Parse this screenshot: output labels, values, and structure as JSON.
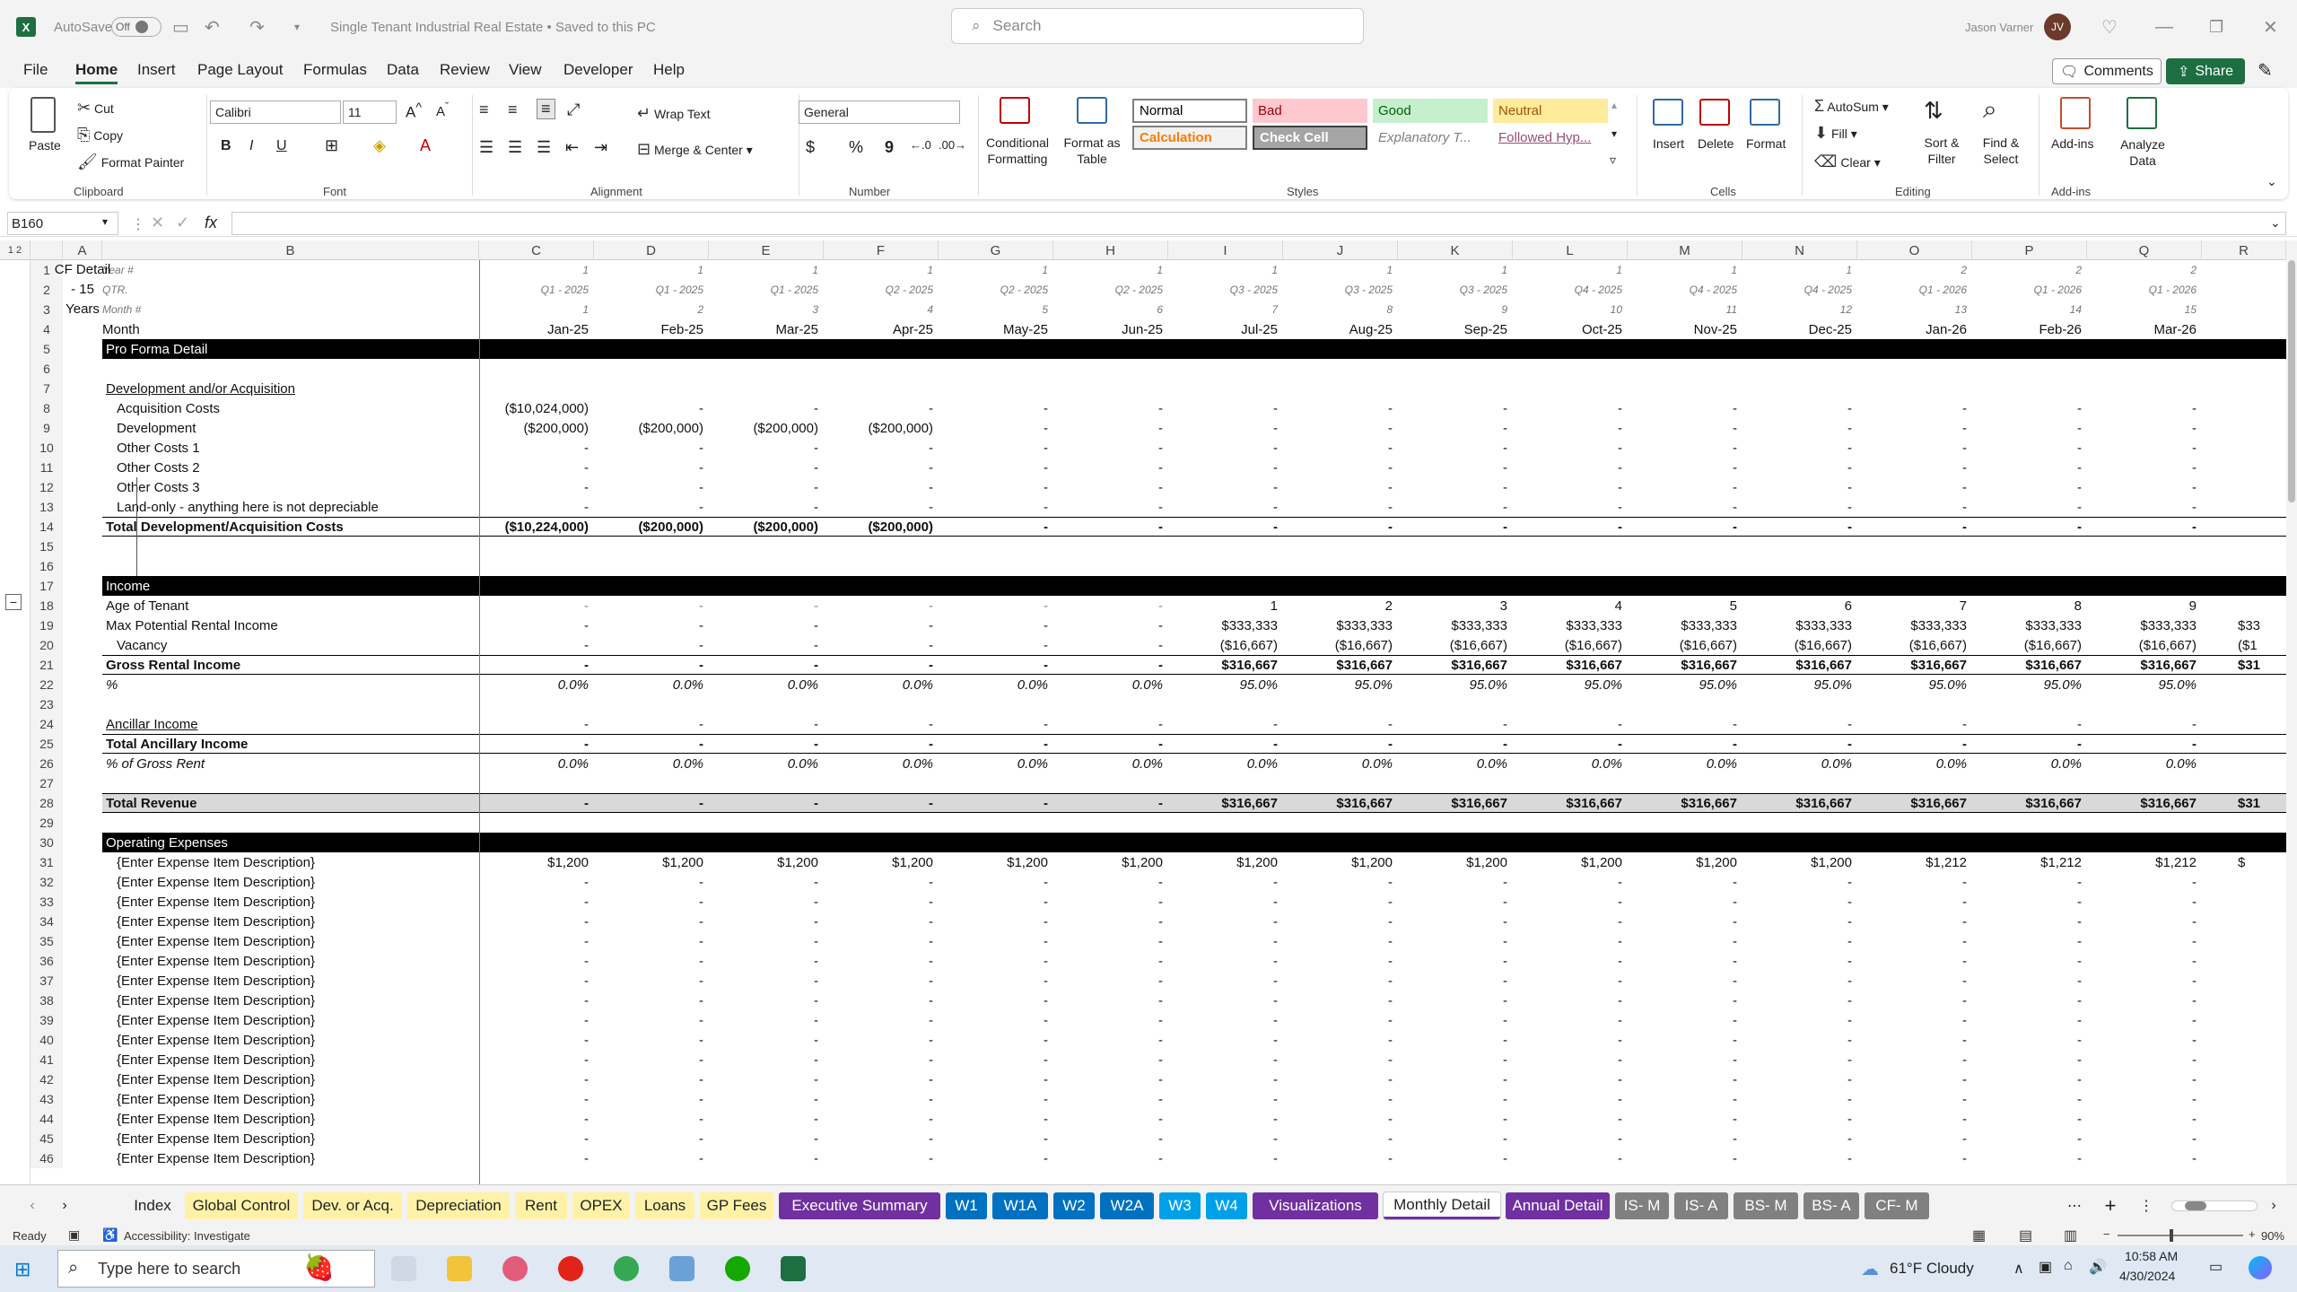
{
  "titlebar": {
    "autosave_label": "AutoSave",
    "autosave_state": "Off",
    "doc_title": "Single Tenant Industrial Real Estate • Saved to this PC",
    "search_placeholder": "Search",
    "user_name": "Jason Varner",
    "user_initials": "JV"
  },
  "menu": {
    "items": [
      "File",
      "Home",
      "Insert",
      "Page Layout",
      "Formulas",
      "Data",
      "Review",
      "View",
      "Developer",
      "Help"
    ],
    "active": "Home",
    "comments_label": "Comments",
    "share_label": "Share"
  },
  "ribbon": {
    "clipboard": {
      "paste": "Paste",
      "cut": "Cut",
      "copy": "Copy",
      "format_painter": "Format Painter",
      "label": "Clipboard"
    },
    "font": {
      "name": "Calibri",
      "size": "11",
      "label": "Font",
      "bold": "B",
      "italic": "I",
      "underline": "U"
    },
    "alignment": {
      "wrap": "Wrap Text",
      "merge": "Merge & Center",
      "label": "Alignment"
    },
    "number": {
      "format": "General",
      "currency": "$",
      "percent": "%",
      "comma": "9",
      "label": "Number"
    },
    "styles": {
      "conditional": "Conditional Formatting",
      "format_table": "Format as Table",
      "label": "Styles",
      "cells": [
        {
          "name": "Normal",
          "bg": "#ffffff",
          "fg": "#000000",
          "border": "#808080"
        },
        {
          "name": "Bad",
          "bg": "#ffc7ce",
          "fg": "#9c0006",
          "border": ""
        },
        {
          "name": "Good",
          "bg": "#c6efce",
          "fg": "#006100",
          "border": ""
        },
        {
          "name": "Neutral",
          "bg": "#ffeb9c",
          "fg": "#9c5700",
          "border": ""
        },
        {
          "name": "Calculation",
          "bg": "#f2f2f2",
          "fg": "#fa7d00",
          "border": "#7f7f7f"
        },
        {
          "name": "Check Cell",
          "bg": "#a5a5a5",
          "fg": "#ffffff",
          "border": "#3f3f3f"
        },
        {
          "name": "Explanatory T...",
          "bg": "#ffffff",
          "fg": "#7f7f7f",
          "border": ""
        },
        {
          "name": "Followed Hyp...",
          "bg": "#ffffff",
          "fg": "#954f72",
          "border": ""
        }
      ]
    },
    "cells_grp": {
      "insert": "Insert",
      "delete": "Delete",
      "format": "Format",
      "label": "Cells"
    },
    "editing": {
      "autosum": "AutoSum",
      "fill": "Fill",
      "clear": "Clear",
      "sort": "Sort & Filter",
      "find": "Find & Select",
      "label": "Editing"
    },
    "addins": {
      "addins": "Add-ins",
      "analyze": "Analyze Data",
      "label": "Add-ins"
    }
  },
  "formula_bar": {
    "name_box": "B160",
    "fx": "fx",
    "content": ""
  },
  "columns": [
    "A",
    "B",
    "C",
    "D",
    "E",
    "F",
    "G",
    "H",
    "I",
    "J",
    "K",
    "L",
    "M",
    "N",
    "O",
    "P",
    "Q",
    "R"
  ],
  "sheet": {
    "a_label": [
      "CF Detail",
      "- 15",
      "Years"
    ],
    "header_rows": {
      "year_label": "Year #",
      "qtr_label": "QTR.",
      "month_num_label": "Month #",
      "month_label": "Month",
      "years": [
        "1",
        "1",
        "1",
        "1",
        "1",
        "1",
        "1",
        "1",
        "1",
        "1",
        "1",
        "1",
        "2",
        "2",
        "2"
      ],
      "qtrs": [
        "Q1 - 2025",
        "Q1 - 2025",
        "Q1 - 2025",
        "Q2 - 2025",
        "Q2 - 2025",
        "Q2 - 2025",
        "Q3 - 2025",
        "Q3 - 2025",
        "Q3 - 2025",
        "Q4 - 2025",
        "Q4 - 2025",
        "Q4 - 2025",
        "Q1 - 2026",
        "Q1 - 2026",
        "Q1 - 2026"
      ],
      "month_nums": [
        "1",
        "2",
        "3",
        "4",
        "5",
        "6",
        "7",
        "8",
        "9",
        "10",
        "11",
        "12",
        "13",
        "14",
        "15"
      ],
      "months": [
        "Jan-25",
        "Feb-25",
        "Mar-25",
        "Apr-25",
        "May-25",
        "Jun-25",
        "Jul-25",
        "Aug-25",
        "Sep-25",
        "Oct-25",
        "Nov-25",
        "Dec-25",
        "Jan-26",
        "Feb-26",
        "Mar-26"
      ]
    },
    "section_proforma": "Pro Forma Detail",
    "dev_header": "Development and/or Acquisition",
    "dev_rows": [
      {
        "label": "Acquisition Costs",
        "vals": [
          "($10,024,000)",
          "-",
          "-",
          "-",
          "-",
          "-",
          "-",
          "-",
          "-",
          "-",
          "-",
          "-",
          "-",
          "-",
          "-"
        ]
      },
      {
        "label": "Development",
        "vals": [
          "($200,000)",
          "($200,000)",
          "($200,000)",
          "($200,000)",
          "-",
          "-",
          "-",
          "-",
          "-",
          "-",
          "-",
          "-",
          "-",
          "-",
          "-"
        ]
      },
      {
        "label": "Other Costs 1",
        "vals": [
          "-",
          "-",
          "-",
          "-",
          "-",
          "-",
          "-",
          "-",
          "-",
          "-",
          "-",
          "-",
          "-",
          "-",
          "-"
        ]
      },
      {
        "label": "Other Costs 2",
        "vals": [
          "-",
          "-",
          "-",
          "-",
          "-",
          "-",
          "-",
          "-",
          "-",
          "-",
          "-",
          "-",
          "-",
          "-",
          "-"
        ]
      },
      {
        "label": "Other Costs 3",
        "vals": [
          "-",
          "-",
          "-",
          "-",
          "-",
          "-",
          "-",
          "-",
          "-",
          "-",
          "-",
          "-",
          "-",
          "-",
          "-"
        ]
      },
      {
        "label": "Land-only - anything here is not depreciable",
        "vals": [
          "-",
          "-",
          "-",
          "-",
          "-",
          "-",
          "-",
          "-",
          "-",
          "-",
          "-",
          "-",
          "-",
          "-",
          "-"
        ]
      }
    ],
    "dev_total": {
      "label": "Total Development/Acquisition Costs",
      "vals": [
        "($10,224,000)",
        "($200,000)",
        "($200,000)",
        "($200,000)",
        "-",
        "-",
        "-",
        "-",
        "-",
        "-",
        "-",
        "-",
        "-",
        "-",
        "-"
      ]
    },
    "income_header": "Income",
    "age": {
      "label": "Age of Tenant",
      "vals": [
        "-",
        "-",
        "-",
        "-",
        "-",
        "-",
        "1",
        "2",
        "3",
        "4",
        "5",
        "6",
        "7",
        "8",
        "9"
      ]
    },
    "mpri": {
      "label": "Max Potential Rental Income",
      "vals": [
        "-",
        "-",
        "-",
        "-",
        "-",
        "-",
        "$333,333",
        "$333,333",
        "$333,333",
        "$333,333",
        "$333,333",
        "$333,333",
        "$333,333",
        "$333,333",
        "$333,333"
      ],
      "overflow": "$33"
    },
    "vacancy": {
      "label": "Vacancy",
      "vals": [
        "-",
        "-",
        "-",
        "-",
        "-",
        "-",
        "($16,667)",
        "($16,667)",
        "($16,667)",
        "($16,667)",
        "($16,667)",
        "($16,667)",
        "($16,667)",
        "($16,667)",
        "($16,667)"
      ],
      "overflow": "($1"
    },
    "gri": {
      "label": "Gross Rental Income",
      "vals": [
        "-",
        "-",
        "-",
        "-",
        "-",
        "-",
        "$316,667",
        "$316,667",
        "$316,667",
        "$316,667",
        "$316,667",
        "$316,667",
        "$316,667",
        "$316,667",
        "$316,667"
      ],
      "overflow": "$31"
    },
    "pct": {
      "label": "%",
      "vals": [
        "0.0%",
        "0.0%",
        "0.0%",
        "0.0%",
        "0.0%",
        "0.0%",
        "95.0%",
        "95.0%",
        "95.0%",
        "95.0%",
        "95.0%",
        "95.0%",
        "95.0%",
        "95.0%",
        "95.0%"
      ]
    },
    "ancillary": {
      "label": "Ancillar Income",
      "vals": [
        "-",
        "-",
        "-",
        "-",
        "-",
        "-",
        "-",
        "-",
        "-",
        "-",
        "-",
        "-",
        "-",
        "-",
        "-"
      ]
    },
    "tot_anc": {
      "label": "Total Ancillary Income",
      "vals": [
        "-",
        "-",
        "-",
        "-",
        "-",
        "-",
        "-",
        "-",
        "-",
        "-",
        "-",
        "-",
        "-",
        "-",
        "-"
      ]
    },
    "pct_gross": {
      "label": "% of Gross Rent",
      "vals": [
        "0.0%",
        "0.0%",
        "0.0%",
        "0.0%",
        "0.0%",
        "0.0%",
        "0.0%",
        "0.0%",
        "0.0%",
        "0.0%",
        "0.0%",
        "0.0%",
        "0.0%",
        "0.0%",
        "0.0%"
      ]
    },
    "tot_rev": {
      "label": "Total Revenue",
      "vals": [
        "-",
        "-",
        "-",
        "-",
        "-",
        "-",
        "$316,667",
        "$316,667",
        "$316,667",
        "$316,667",
        "$316,667",
        "$316,667",
        "$316,667",
        "$316,667",
        "$316,667"
      ],
      "overflow": "$31"
    },
    "opex_header": "Operating Expenses",
    "opex_label": "{Enter Expense Item Description}",
    "opex_first": {
      "vals": [
        "$1,200",
        "$1,200",
        "$1,200",
        "$1,200",
        "$1,200",
        "$1,200",
        "$1,200",
        "$1,200",
        "$1,200",
        "$1,200",
        "$1,200",
        "$1,200",
        "$1,212",
        "$1,212",
        "$1,212"
      ],
      "overflow": "$"
    },
    "dash": "-"
  },
  "tabs": [
    {
      "label": "Index",
      "bg": "#f3f3f3",
      "fg": "#222"
    },
    {
      "label": "Global Control",
      "bg": "#fff2a8",
      "fg": "#222"
    },
    {
      "label": "Dev. or Acq.",
      "bg": "#fff2a8",
      "fg": "#222"
    },
    {
      "label": "Depreciation",
      "bg": "#fff2a8",
      "fg": "#222"
    },
    {
      "label": "Rent",
      "bg": "#fff2a8",
      "fg": "#222"
    },
    {
      "label": "OPEX",
      "bg": "#fff2a8",
      "fg": "#222"
    },
    {
      "label": "Loans",
      "bg": "#fff2a8",
      "fg": "#222"
    },
    {
      "label": "GP Fees",
      "bg": "#fff2a8",
      "fg": "#222"
    },
    {
      "label": "Executive Summary",
      "bg": "#7030a0",
      "fg": "#fff"
    },
    {
      "label": "W1",
      "bg": "#0070c0",
      "fg": "#fff"
    },
    {
      "label": "W1A",
      "bg": "#0070c0",
      "fg": "#fff"
    },
    {
      "label": "W2",
      "bg": "#0070c0",
      "fg": "#fff"
    },
    {
      "label": "W2A",
      "bg": "#0070c0",
      "fg": "#fff"
    },
    {
      "label": "W3",
      "bg": "#00a0e9",
      "fg": "#fff"
    },
    {
      "label": "W4",
      "bg": "#00a0e9",
      "fg": "#fff"
    },
    {
      "label": "Visualizations",
      "bg": "#7030a0",
      "fg": "#fff"
    },
    {
      "label": "Monthly Detail",
      "bg": "#ffffff",
      "fg": "#222"
    },
    {
      "label": "Annual Detail",
      "bg": "#7030a0",
      "fg": "#fff"
    },
    {
      "label": "IS- M",
      "bg": "#808080",
      "fg": "#fff"
    },
    {
      "label": "IS- A",
      "bg": "#808080",
      "fg": "#fff"
    },
    {
      "label": "BS- M",
      "bg": "#808080",
      "fg": "#fff"
    },
    {
      "label": "BS- A",
      "bg": "#808080",
      "fg": "#fff"
    },
    {
      "label": "CF- M",
      "bg": "#808080",
      "fg": "#fff"
    }
  ],
  "status": {
    "ready": "Ready",
    "accessibility": "Accessibility: Investigate",
    "zoom": "90%"
  },
  "taskbar": {
    "search": "Type here to search",
    "weather": "61°F  Cloudy",
    "time": "10:58 AM",
    "date": "4/30/2024"
  }
}
